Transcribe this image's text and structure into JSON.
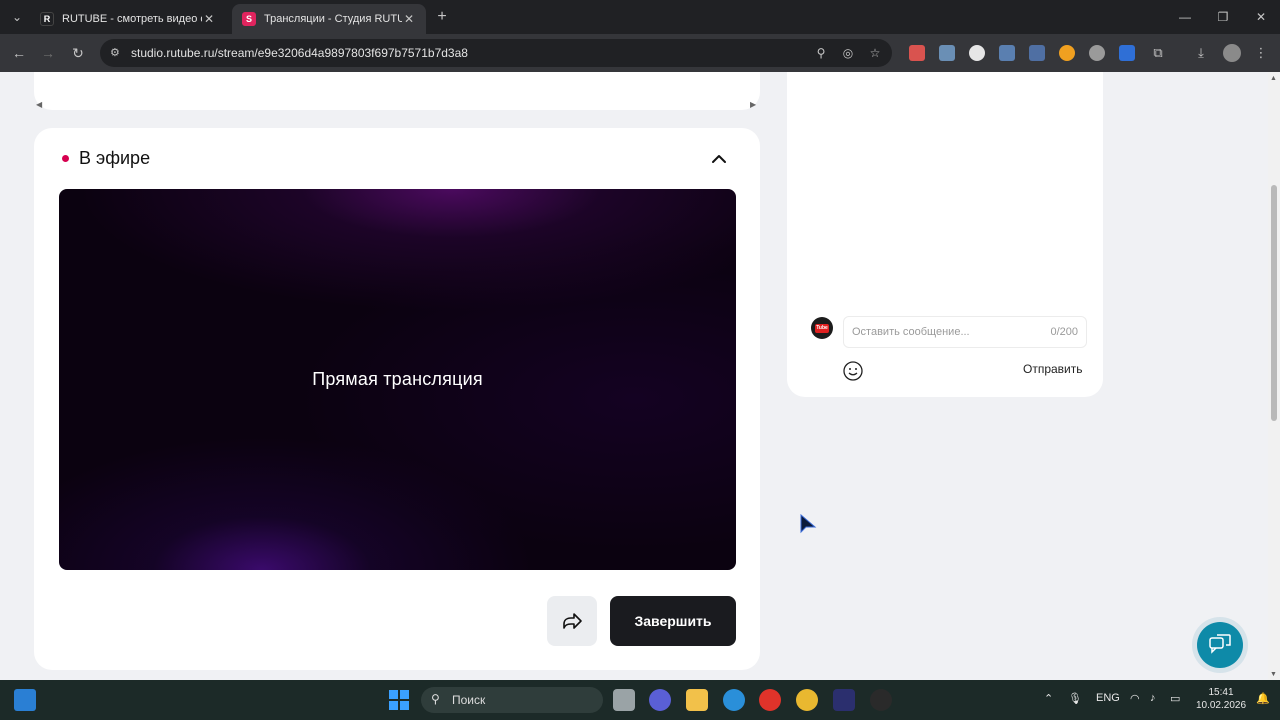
{
  "browser": {
    "tabs": [
      {
        "title": "RUTUBE - смотреть видео онлайн",
        "favicon": "R",
        "active": false
      },
      {
        "title": "Трансляции - Студия RUTUBE",
        "favicon": "S",
        "active": true
      }
    ],
    "new_tab": "+",
    "url": "studio.rutube.ru/stream/e9e3206d4a9897803f697b7571b7d3a8"
  },
  "live": {
    "title": "В эфире",
    "player_text": "Прямая трансляция",
    "finish_label": "Завершить"
  },
  "chat": {
    "placeholder": "Оставить сообщение...",
    "counter": "0/200",
    "send_label": "Отправить",
    "avatar_text": "Tube"
  },
  "taskbar": {
    "search_label": "Поиск",
    "language": "ENG",
    "time": "15:41",
    "date": "10.02.2026"
  },
  "colors": {
    "accent": "#d6004f",
    "finish_button": "#1a1b1f",
    "support_button": "#0e8aa8",
    "page_background": "#f0f1f4"
  },
  "icons": [
    "tab-menu-icon",
    "close-icon",
    "back-icon",
    "forward-icon",
    "reload-icon",
    "site-info-icon",
    "zoom-icon",
    "eye-off-icon",
    "star-icon",
    "extensions-icon",
    "download-icon",
    "menu-icon",
    "chevron-up-icon",
    "share-icon",
    "emoji-icon",
    "support-chat-icon",
    "windows-logo-icon",
    "search-icon",
    "wifi-icon",
    "volume-icon",
    "battery-icon",
    "notification-icon"
  ]
}
